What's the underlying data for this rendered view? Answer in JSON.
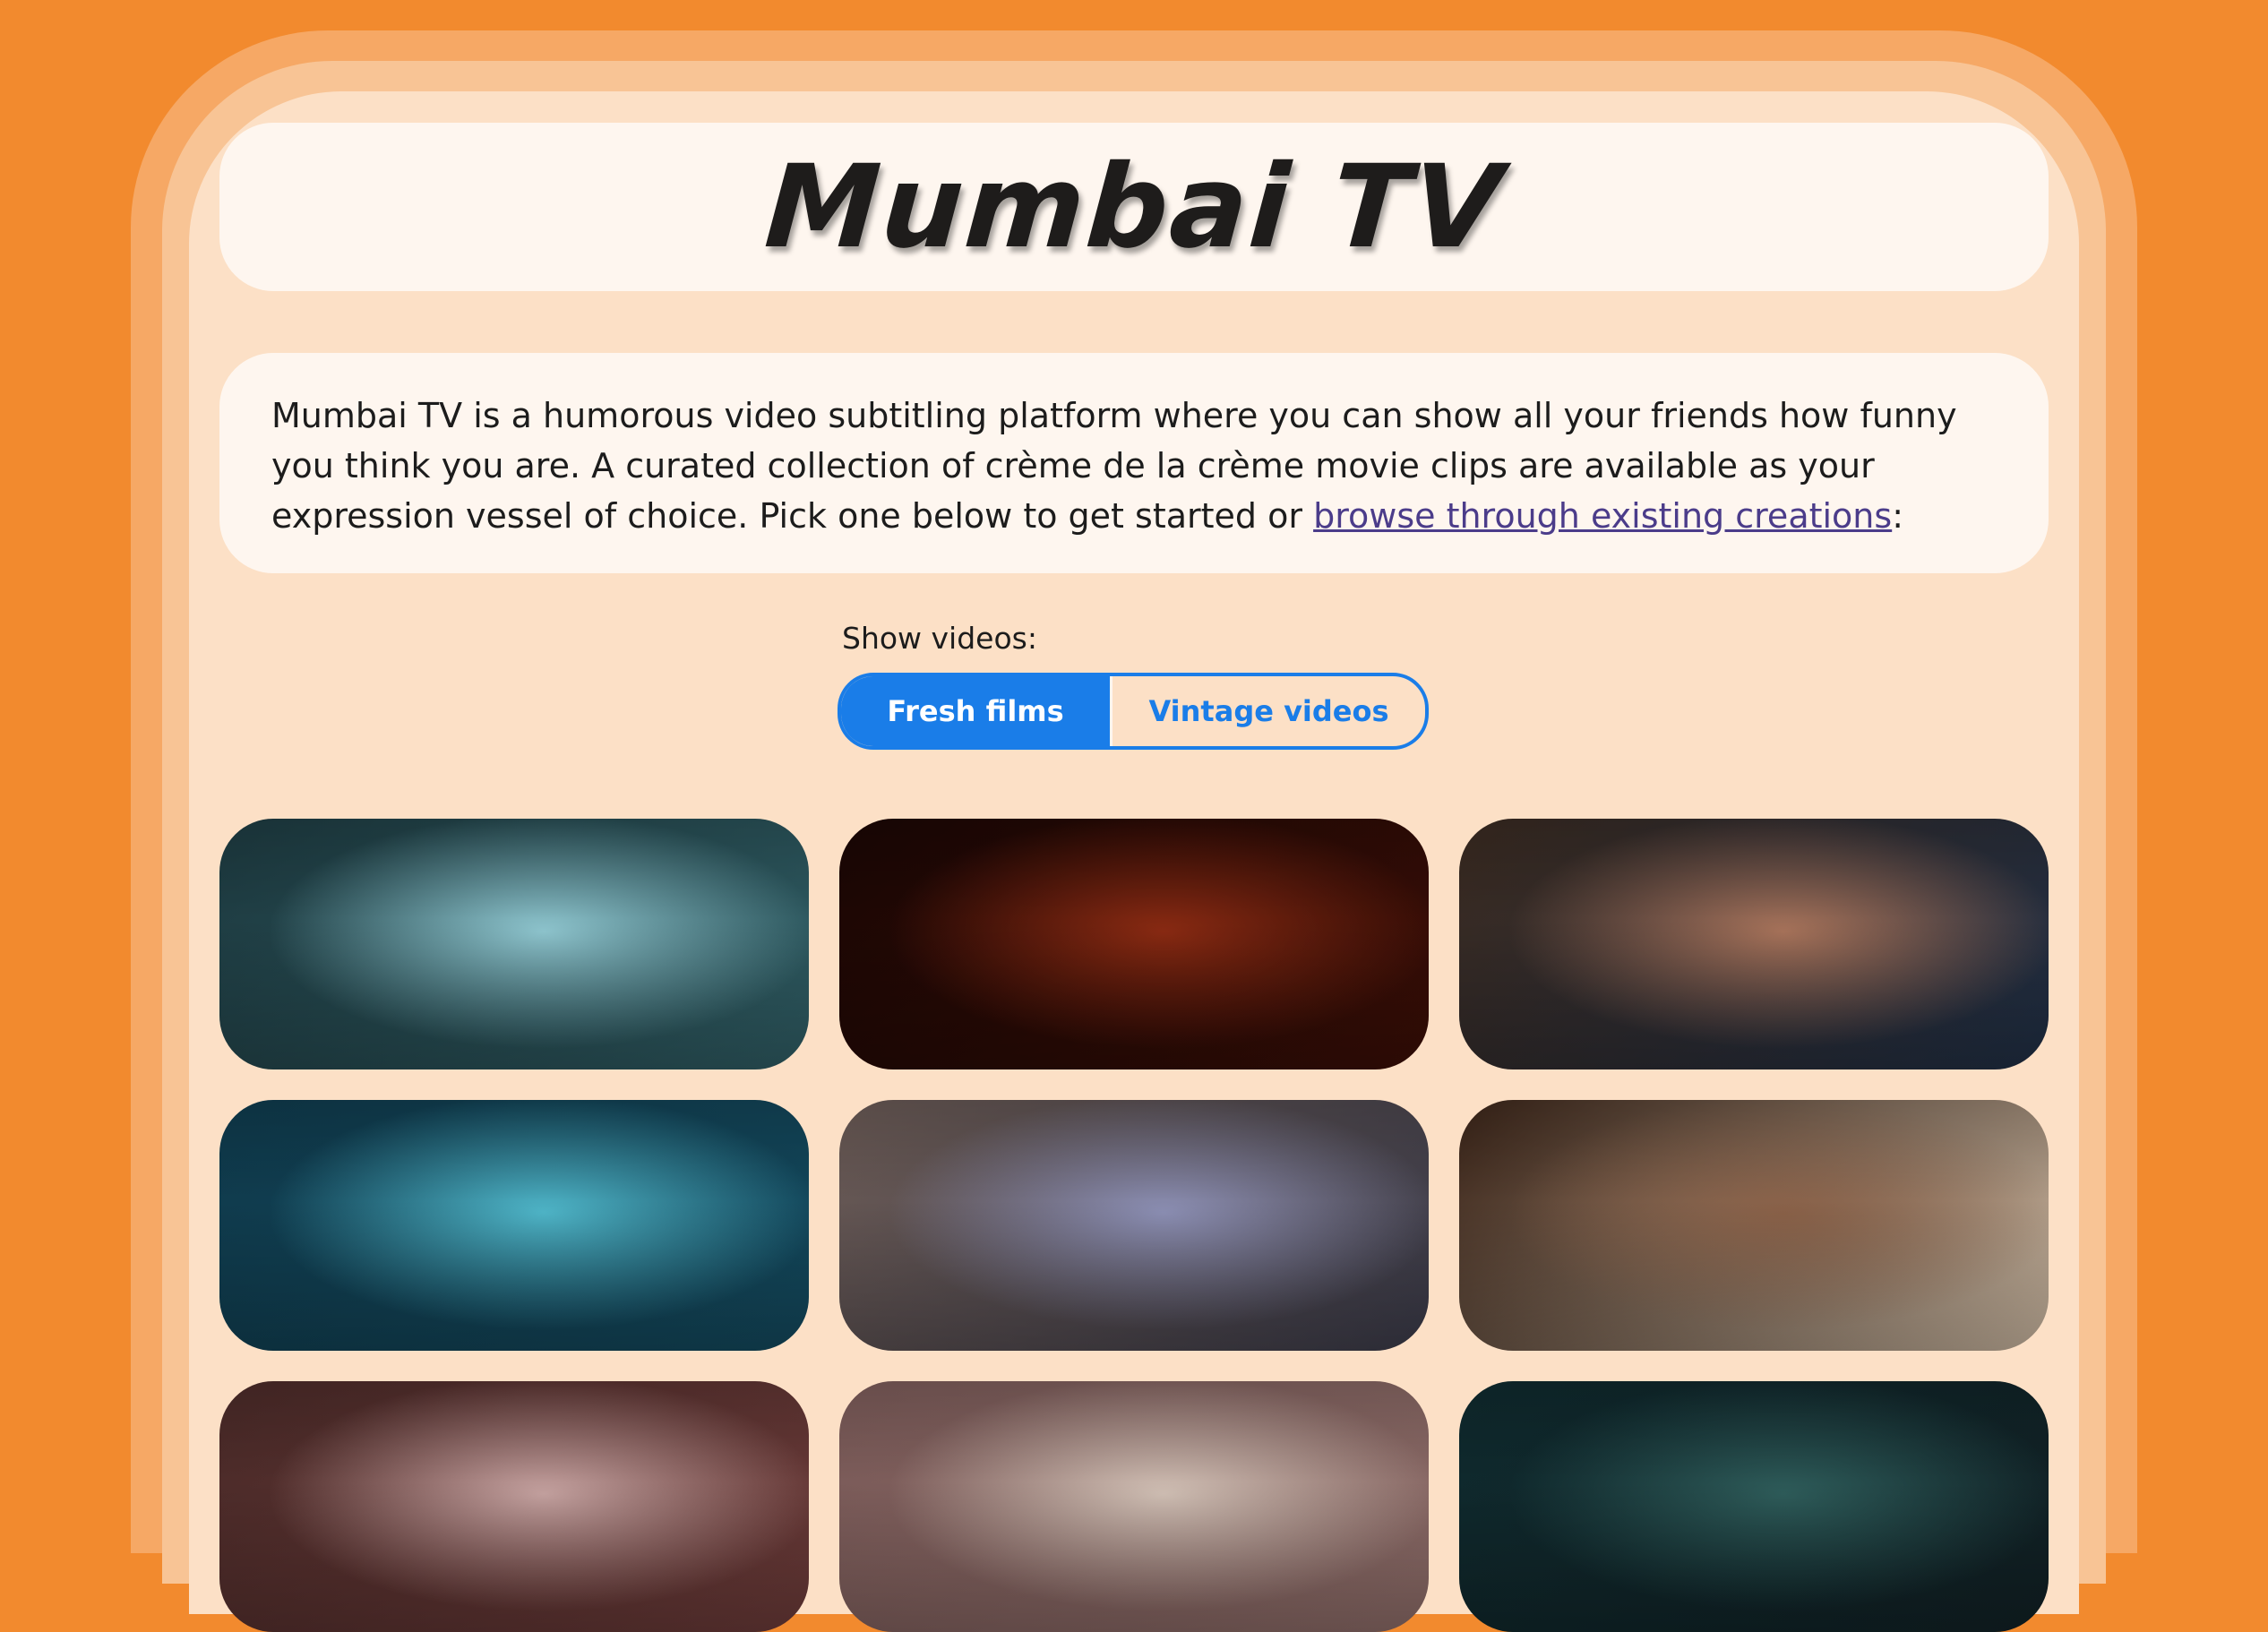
{
  "header": {
    "title": "Mumbai TV"
  },
  "intro": {
    "text": "Mumbai TV is a humorous video subtitling platform where you can show all your friends how funny you think you are. A curated collection of crème de la crème movie clips are available as your expression vessel of choice. Pick one below to get started or ",
    "link_text": "browse through existing creations",
    "suffix": ":"
  },
  "filter": {
    "label": "Show videos:",
    "options": [
      "Fresh films",
      "Vintage videos"
    ],
    "selected": "Fresh films"
  },
  "videos": [
    {
      "scene": "airport-terminal-scene",
      "colors": [
        "#1d3a40",
        "#8fc6cf",
        "#2f5c63"
      ]
    },
    {
      "scene": "red-sperm-animation-scene",
      "colors": [
        "#1a0604",
        "#8a2a12",
        "#3a0e06"
      ]
    },
    {
      "scene": "jeans-backs-scene",
      "colors": [
        "#3a2a20",
        "#a8735a",
        "#1f2e44"
      ]
    },
    {
      "scene": "blue-tinted-shirt-scene",
      "colors": [
        "#0f3a4c",
        "#4fb6c9",
        "#13485c"
      ]
    },
    {
      "scene": "restaurant-conversation-scene",
      "colors": [
        "#6a5a55",
        "#8c8fb4",
        "#3a3a48"
      ]
    },
    {
      "scene": "bar-counter-scene",
      "colors": [
        "#3a2418",
        "#8a6148",
        "#c9b6a0"
      ]
    },
    {
      "scene": "shop-interior-scene",
      "colors": [
        "#4a2a28",
        "#c5a2a0",
        "#6a3a38"
      ]
    },
    {
      "scene": "room-doorway-scene",
      "colors": [
        "#7a5a58",
        "#d0bfb4",
        "#8a6a66"
      ]
    },
    {
      "scene": "bamboo-forest-scene",
      "colors": [
        "#0f2a2e",
        "#2e5c5a",
        "#112024"
      ]
    }
  ]
}
